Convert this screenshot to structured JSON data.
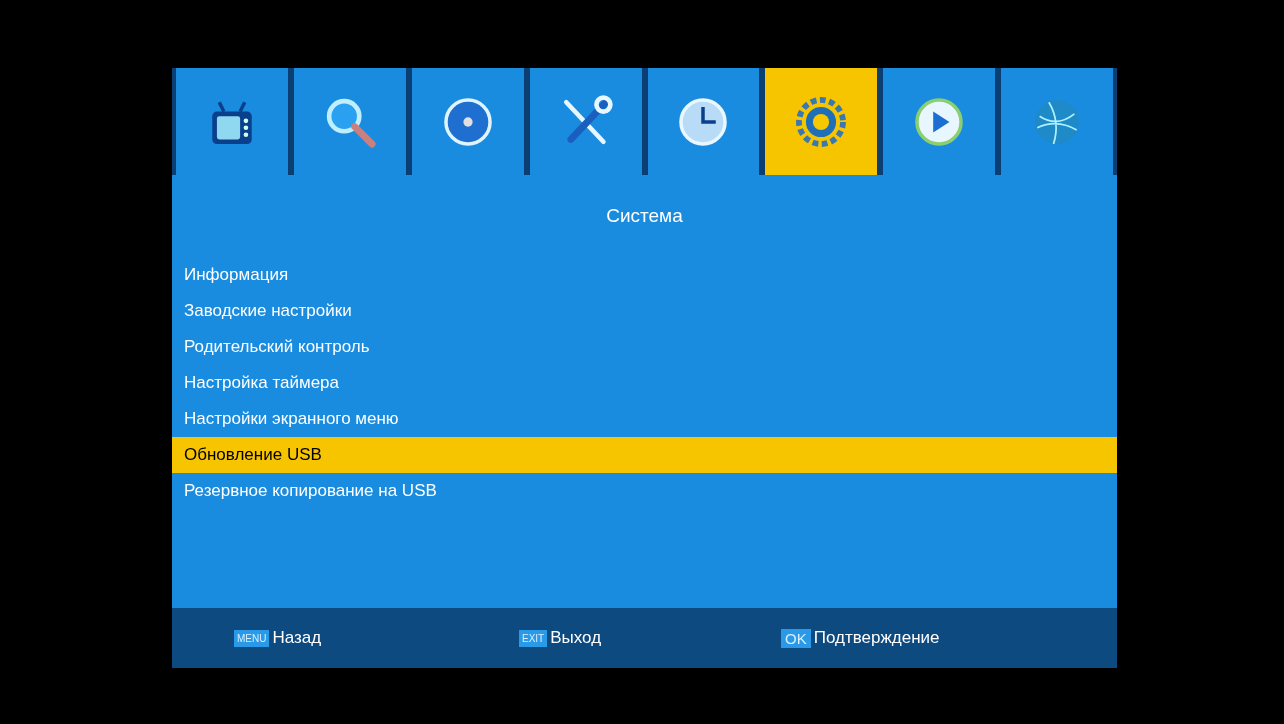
{
  "tabs": [
    {
      "kind": "tv",
      "selected": false
    },
    {
      "kind": "search",
      "selected": false
    },
    {
      "kind": "disc",
      "selected": false
    },
    {
      "kind": "tools",
      "selected": false
    },
    {
      "kind": "clock",
      "selected": false
    },
    {
      "kind": "gear",
      "selected": true
    },
    {
      "kind": "play",
      "selected": false
    },
    {
      "kind": "globe",
      "selected": false
    }
  ],
  "title": "Система",
  "items": [
    {
      "label": "Информация",
      "selected": false
    },
    {
      "label": "Заводские настройки",
      "selected": false
    },
    {
      "label": "Родительский контроль",
      "selected": false
    },
    {
      "label": "Настройка таймера",
      "selected": false
    },
    {
      "label": "Настройки экранного меню",
      "selected": false
    },
    {
      "label": "Обновление USB",
      "selected": true
    },
    {
      "label": "Резервное копирование на USB",
      "selected": false
    }
  ],
  "footer": [
    {
      "key": "MENU",
      "label": "Назад"
    },
    {
      "key": "EXIT",
      "label": "Выход"
    },
    {
      "key": "OK",
      "label": "Подтверждение"
    }
  ]
}
